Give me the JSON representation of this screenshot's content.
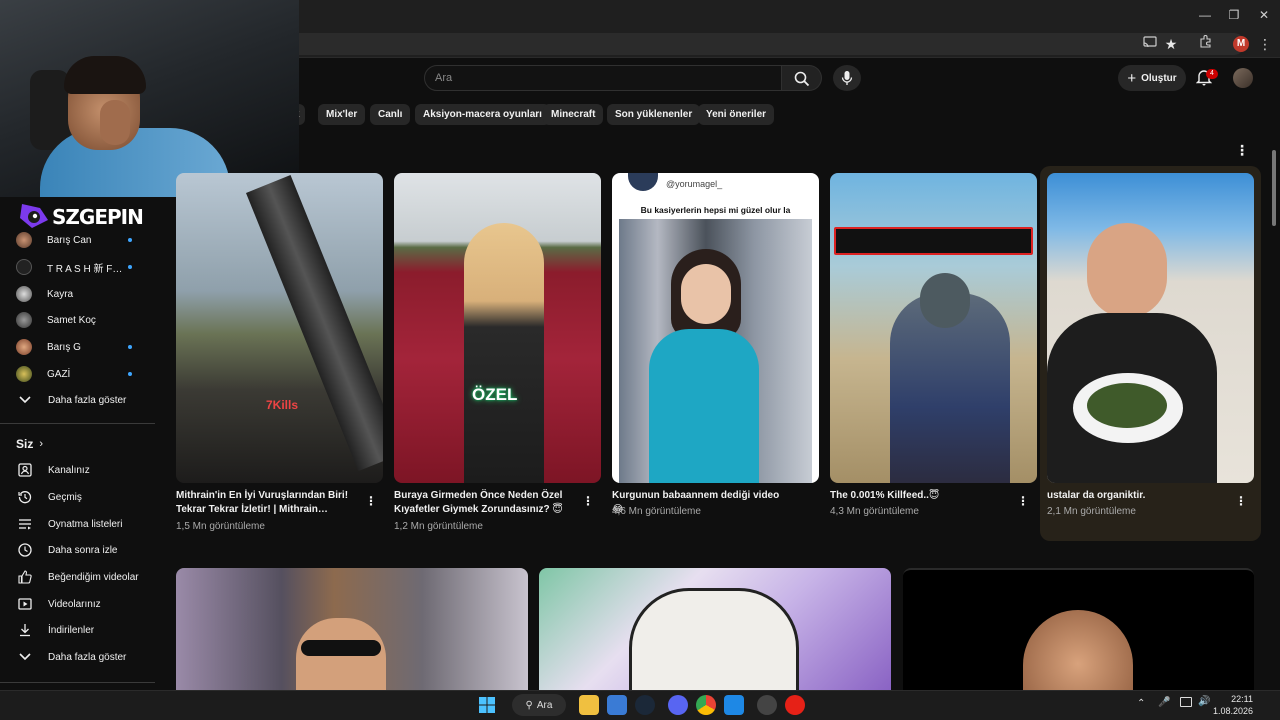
{
  "browser": {
    "profile_initial": "M",
    "icons": [
      "cast-icon",
      "bookmark-star-icon",
      "extensions-icon",
      "profile-icon",
      "more-icon"
    ]
  },
  "youtube": {
    "search_placeholder": "Ara",
    "create_label": "Oluştur",
    "notif_count": "4"
  },
  "chips": [
    "k",
    "Mix'ler",
    "Canlı",
    "Aksiyon-macera oyunları",
    "Minecraft",
    "Son yüklenenler",
    "Yeni öneriler"
  ],
  "logo_text": "SZGEPIN",
  "sidebar": {
    "subscriptions": [
      {
        "label": "Barış Can",
        "live": true
      },
      {
        "label": "T R A S H 新 F…",
        "live": true
      },
      {
        "label": "Kayra",
        "live": false
      },
      {
        "label": "Samet Koç",
        "live": false
      },
      {
        "label": "Barış G",
        "live": true
      },
      {
        "label": "GAZİ",
        "live": true
      }
    ],
    "show_more_subs": "Daha fazla göster",
    "you_header": "Siz",
    "you_items": [
      {
        "label": "Kanalınız",
        "icon": "channel-icon"
      },
      {
        "label": "Geçmiş",
        "icon": "history-icon"
      },
      {
        "label": "Oynatma listeleri",
        "icon": "playlists-icon"
      },
      {
        "label": "Daha sonra izle",
        "icon": "watch-later-icon"
      },
      {
        "label": "Beğendiğim videolar",
        "icon": "liked-icon"
      },
      {
        "label": "Videolarınız",
        "icon": "your-videos-icon"
      },
      {
        "label": "İndirilenler",
        "icon": "downloads-icon"
      }
    ],
    "show_more_you": "Daha fazla göster"
  },
  "videos": [
    {
      "title": "Mithrain'in En İyi Vuruşlarından Biri! Tekrar Tekrar İzletir! | Mithrain PUBG…",
      "views": "1,5 Mn görüntüleme",
      "overlay": "7Kills"
    },
    {
      "title": "Buraya Girmeden Önce Neden Özel Kıyafetler Giymek Zorundasınız? 😇",
      "views": "1,2 Mn görüntüleme",
      "overlay": "ÖZEL"
    },
    {
      "title": "Kurgunun babaannem dediği video 😂",
      "views": "4,6 Mn görüntüleme",
      "overlay": "Bu kasiyerlerin hepsi mi güzel olur la",
      "handle": "@yorumagel_"
    },
    {
      "title": "The 0.001% Killfeed..😇",
      "views": "4,3 Mn görüntüleme"
    },
    {
      "title": "ustalar da organiktir.",
      "views": "2,1 Mn görüntüleme"
    }
  ],
  "taskbar": {
    "search_label": "Ara",
    "time": "22:11",
    "date": "1.08.2026"
  }
}
